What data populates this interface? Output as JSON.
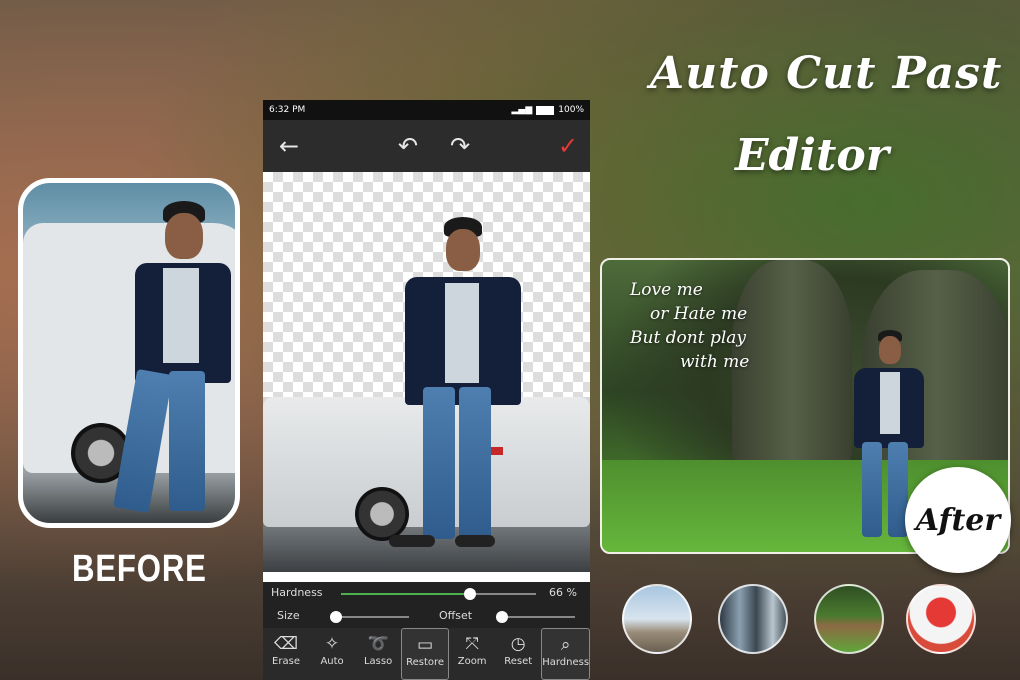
{
  "title": {
    "line1": "Auto Cut Past",
    "line2": "Editor"
  },
  "before": {
    "label": "BEFORE"
  },
  "after": {
    "badge": "After",
    "quote": [
      "Love me",
      "or Hate me",
      "But dont play",
      "with me"
    ]
  },
  "phone": {
    "status": {
      "time": "6:32 PM",
      "battery": "100%"
    },
    "toolbar": {
      "back_icon": "back-arrow-icon",
      "undo_icon": "undo-icon",
      "redo_icon": "redo-icon",
      "done_icon": "check-icon",
      "done_color": "#e53935"
    },
    "controls": {
      "hardness_label": "Hardness",
      "hardness_value_text": "66 %",
      "hardness_value": 0.66,
      "size_label": "Size",
      "size_value": 0.02,
      "offset_label": "Offset",
      "offset_value": 0.02
    },
    "tools": [
      {
        "label": "Erase",
        "icon": "eraser-icon"
      },
      {
        "label": "Auto",
        "icon": "auto-wand-icon"
      },
      {
        "label": "Lasso",
        "icon": "lasso-icon"
      },
      {
        "label": "Restore",
        "icon": "restore-icon",
        "active": true
      },
      {
        "label": "Zoom",
        "icon": "zoom-icon"
      },
      {
        "label": "Reset",
        "icon": "reset-icon"
      },
      {
        "label": "Hardness",
        "icon": "hardness-icon"
      }
    ]
  },
  "thumbnails": [
    {
      "name": "city-skyline"
    },
    {
      "name": "city-buildings"
    },
    {
      "name": "forest"
    },
    {
      "name": "heart-tree"
    }
  ],
  "colors": {
    "accent_green": "#4caf50",
    "text_white": "#ffffff"
  }
}
